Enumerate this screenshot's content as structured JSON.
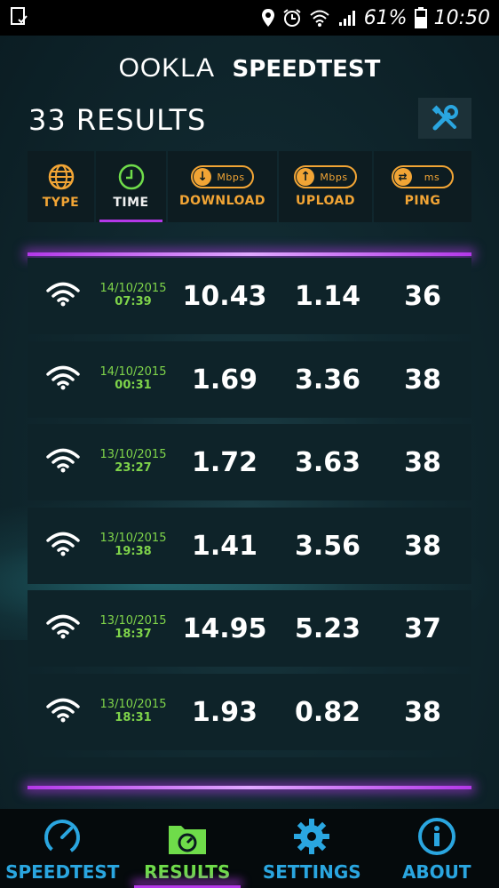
{
  "status_bar": {
    "battery": "61%",
    "time": "10:50"
  },
  "header": {
    "brand_ookla": "OOKLA",
    "brand_speedtest": "SPEEDTEST"
  },
  "results_title": "33 RESULTS",
  "tabs": [
    {
      "label": "TYPE",
      "icon": "globe-icon"
    },
    {
      "label": "TIME",
      "icon": "clock-icon"
    },
    {
      "label": "DOWNLOAD",
      "unit": "Mbps",
      "icon": "download-arrow-icon"
    },
    {
      "label": "UPLOAD",
      "unit": "Mbps",
      "icon": "upload-arrow-icon"
    },
    {
      "label": "PING",
      "unit": "ms",
      "icon": "ping-arrows-icon"
    }
  ],
  "results": [
    {
      "date": "14/10/2015",
      "time": "07:39",
      "download": "10.43",
      "upload": "1.14",
      "ping": "36"
    },
    {
      "date": "14/10/2015",
      "time": "00:31",
      "download": "1.69",
      "upload": "3.36",
      "ping": "38"
    },
    {
      "date": "13/10/2015",
      "time": "23:27",
      "download": "1.72",
      "upload": "3.63",
      "ping": "38"
    },
    {
      "date": "13/10/2015",
      "time": "19:38",
      "download": "1.41",
      "upload": "3.56",
      "ping": "38"
    },
    {
      "date": "13/10/2015",
      "time": "18:37",
      "download": "14.95",
      "upload": "5.23",
      "ping": "37"
    },
    {
      "date": "13/10/2015",
      "time": "18:31",
      "download": "1.93",
      "upload": "0.82",
      "ping": "38"
    }
  ],
  "nav": [
    {
      "label": "SPEEDTEST",
      "icon": "speedometer-icon"
    },
    {
      "label": "RESULTS",
      "icon": "results-folder-icon"
    },
    {
      "label": "SETTINGS",
      "icon": "gear-icon"
    },
    {
      "label": "ABOUT",
      "icon": "info-icon"
    }
  ],
  "colors": {
    "accent_orange": "#f2a535",
    "accent_purple": "#b338e8",
    "accent_blue": "#2aa6e0",
    "accent_green": "#6fdc4a"
  }
}
